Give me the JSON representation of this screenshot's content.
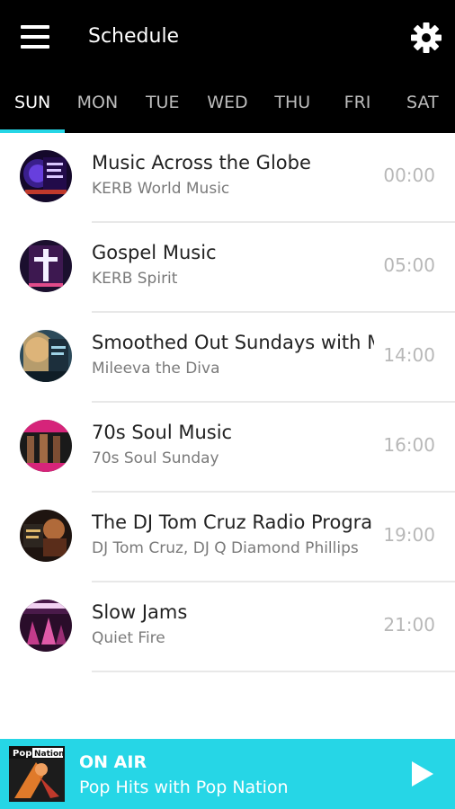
{
  "header": {
    "title": "Schedule",
    "menu_icon": "menu-icon",
    "settings_icon": "gear-icon"
  },
  "tabs": [
    {
      "label": "SUN",
      "active": true
    },
    {
      "label": "MON",
      "active": false
    },
    {
      "label": "TUE",
      "active": false
    },
    {
      "label": "WED",
      "active": false
    },
    {
      "label": "THU",
      "active": false
    },
    {
      "label": "FRI",
      "active": false
    },
    {
      "label": "SAT",
      "active": false
    }
  ],
  "schedule": [
    {
      "title": "Music Across the Globe",
      "host": "KERB World Music",
      "time": "00:00",
      "thumbnail_label": "KERB WORLD MUSIC"
    },
    {
      "title": "Gospel Music",
      "host": "KERB Spirit",
      "time": "05:00"
    },
    {
      "title": "Smoothed Out Sundays with M",
      "host": "Mileeva the Diva",
      "time": "14:00"
    },
    {
      "title": "70s Soul Music",
      "host": "70s Soul Sunday",
      "time": "16:00"
    },
    {
      "title": "The DJ Tom Cruz Radio Progra",
      "host": "DJ Tom Cruz, DJ Q Diamond Phillips",
      "time": "19:00"
    },
    {
      "title": "Slow Jams",
      "host": "Quiet Fire",
      "time": "21:00"
    }
  ],
  "player": {
    "status": "ON AIR",
    "now_playing": "Pop Hits with Pop Nation",
    "art_label": "Pop Nation",
    "play_icon": "play-icon"
  },
  "colors": {
    "header_bg": "#000000",
    "accent": "#26d6e6",
    "title_text": "#222222",
    "subtitle_text": "#7a7a7a",
    "time_text": "#b8b8b8"
  }
}
